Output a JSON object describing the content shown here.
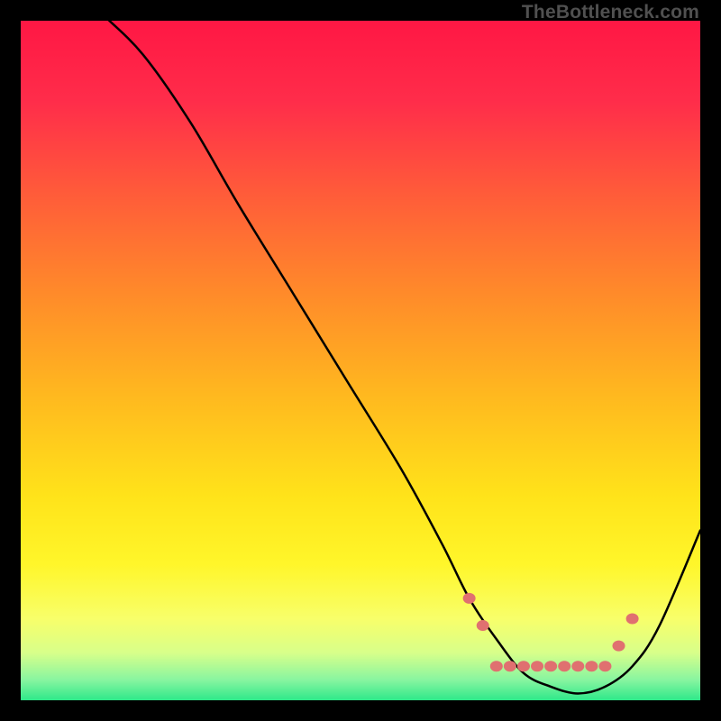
{
  "watermark": "TheBottleneck.com",
  "chart_data": {
    "type": "line",
    "title": "",
    "xlabel": "",
    "ylabel": "",
    "xlim": [
      0,
      100
    ],
    "ylim": [
      0,
      100
    ],
    "series": [
      {
        "name": "bottleneck-curve",
        "x": [
          0,
          8,
          12,
          18,
          25,
          32,
          40,
          48,
          56,
          62,
          66,
          70,
          74,
          78,
          82,
          86,
          90,
          94,
          100
        ],
        "y": [
          110,
          105,
          101,
          95,
          85,
          73,
          60,
          47,
          34,
          23,
          15,
          9,
          4,
          2,
          1,
          2,
          5,
          11,
          25
        ]
      }
    ],
    "markers": {
      "name": "highlight-dots",
      "color": "#e07070",
      "points": [
        {
          "x": 66,
          "y": 15
        },
        {
          "x": 68,
          "y": 11
        },
        {
          "x": 70,
          "y": 5
        },
        {
          "x": 72,
          "y": 5
        },
        {
          "x": 74,
          "y": 5
        },
        {
          "x": 76,
          "y": 5
        },
        {
          "x": 78,
          "y": 5
        },
        {
          "x": 80,
          "y": 5
        },
        {
          "x": 82,
          "y": 5
        },
        {
          "x": 84,
          "y": 5
        },
        {
          "x": 86,
          "y": 5
        },
        {
          "x": 88,
          "y": 8
        },
        {
          "x": 90,
          "y": 12
        }
      ]
    },
    "gradient_stops": [
      {
        "offset": 0,
        "color": "#ff1744"
      },
      {
        "offset": 12,
        "color": "#ff2d4a"
      },
      {
        "offset": 25,
        "color": "#ff5a3a"
      },
      {
        "offset": 40,
        "color": "#ff8a2a"
      },
      {
        "offset": 55,
        "color": "#ffb81f"
      },
      {
        "offset": 70,
        "color": "#ffe31a"
      },
      {
        "offset": 80,
        "color": "#fff62a"
      },
      {
        "offset": 88,
        "color": "#f8ff6a"
      },
      {
        "offset": 93,
        "color": "#d8ff8a"
      },
      {
        "offset": 97,
        "color": "#88f5a0"
      },
      {
        "offset": 100,
        "color": "#2ee88a"
      }
    ]
  }
}
